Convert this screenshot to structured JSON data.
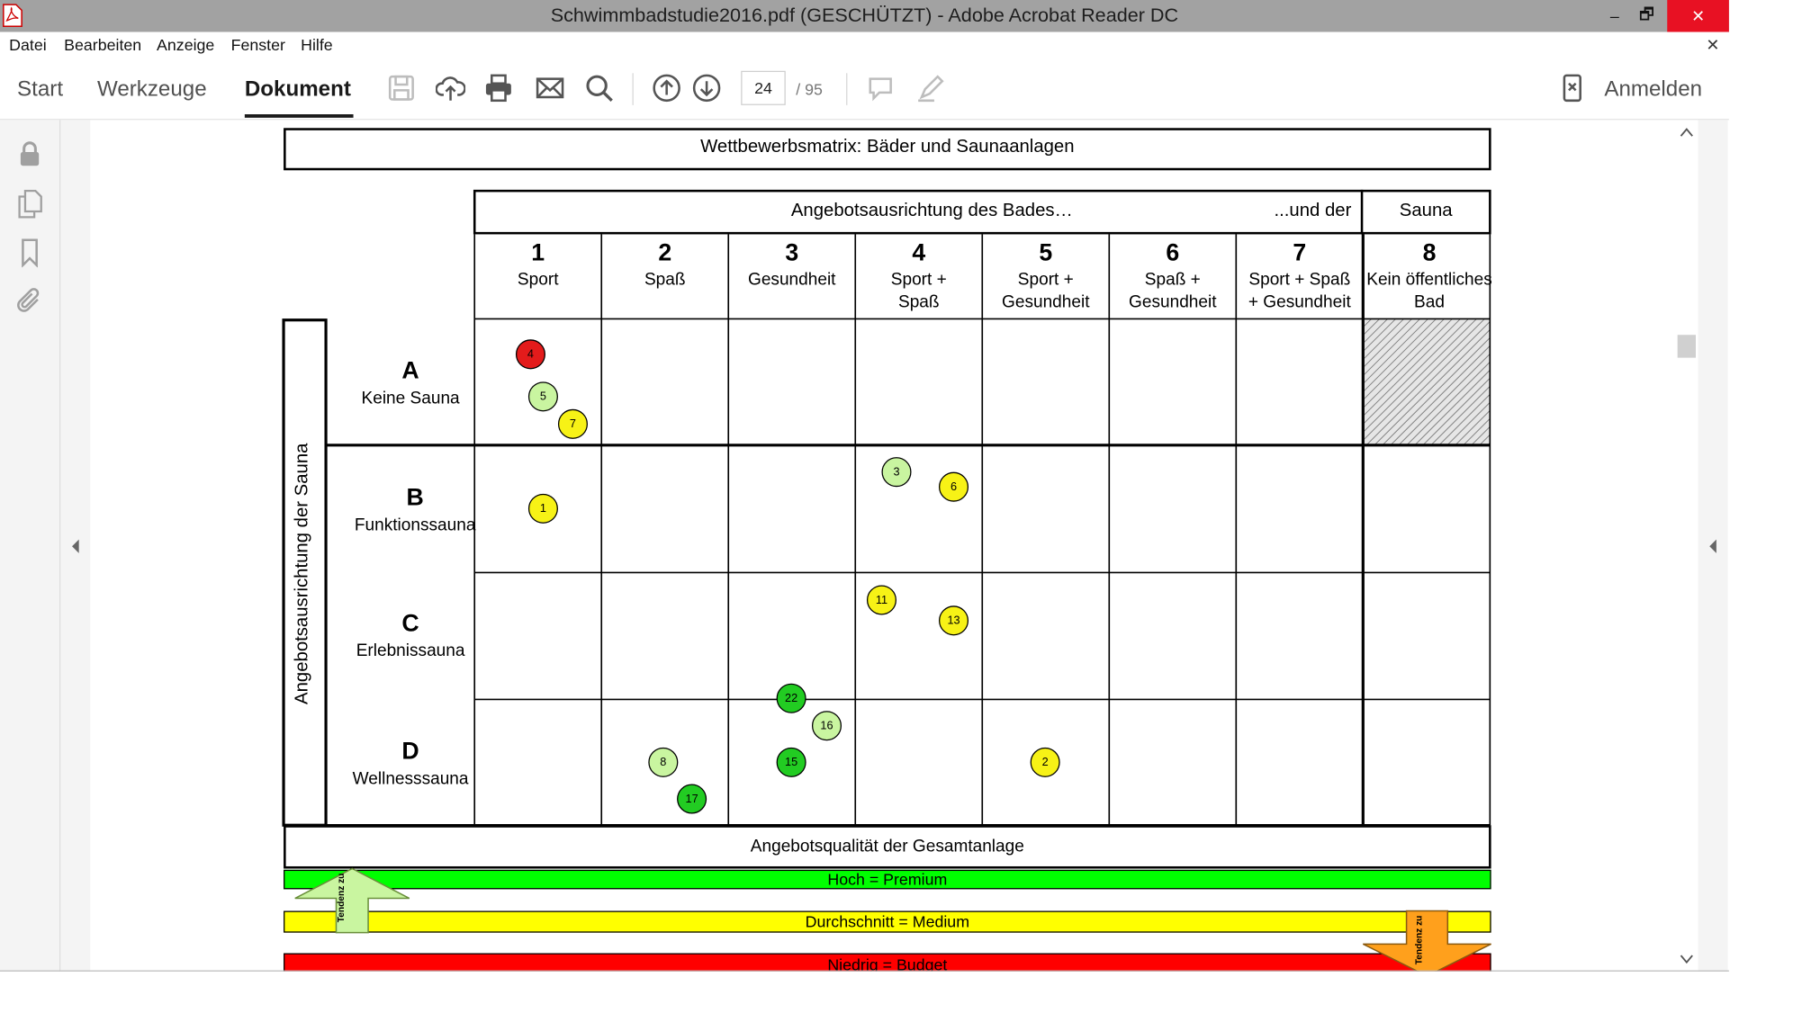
{
  "window": {
    "title": "Schwimmbadstudie2016.pdf (GESCHÜTZT) - Adobe Acrobat Reader DC",
    "minimize": "–",
    "maximize": "🗗",
    "close": "✕"
  },
  "menu": {
    "items": [
      "Datei",
      "Bearbeiten",
      "Anzeige",
      "Fenster",
      "Hilfe"
    ],
    "close_doc": "✕"
  },
  "toolbar": {
    "tabs": [
      "Start",
      "Werkzeuge",
      "Dokument"
    ],
    "active_tab": "Dokument",
    "page_current": "24",
    "page_total": "/ 95",
    "login": "Anmelden",
    "icons": [
      "save-icon",
      "upload-icon",
      "print-icon",
      "mail-icon",
      "search-icon",
      "page-up-icon",
      "page-down-icon",
      "comment-icon",
      "pen-icon",
      "mobile-icon"
    ]
  },
  "sidebar": {
    "icons": [
      "lock-icon",
      "pages-icon",
      "bookmark-icon",
      "attachment-icon"
    ]
  },
  "matrix": {
    "title": "Wettbewerbsmatrix: Bäder und Saunaanlagen",
    "header_main": "Angebotsausrichtung des Bades…",
    "header_und": "...und der",
    "header_sauna": "Sauna",
    "columns": [
      {
        "num": "1",
        "label": "Sport"
      },
      {
        "num": "2",
        "label": "Spaß"
      },
      {
        "num": "3",
        "label": "Gesundheit"
      },
      {
        "num": "4",
        "label": "Sport +\nSpaß"
      },
      {
        "num": "5",
        "label": "Sport +\nGesundheit"
      },
      {
        "num": "6",
        "label": "Spaß +\nGesundheit"
      },
      {
        "num": "7",
        "label": "Sport + Spaß\n+ Gesundheit"
      },
      {
        "num": "8",
        "label": "Kein öffentliches\nBad"
      }
    ],
    "row_axis_label": "Angebotsausrichtung der Sauna",
    "rows": [
      {
        "letter": "A",
        "label": "Keine Sauna"
      },
      {
        "letter": "B",
        "label": "Funktionssauna"
      },
      {
        "letter": "C",
        "label": "Erlebnissauna"
      },
      {
        "letter": "D",
        "label": "Wellnesssauna"
      }
    ],
    "markers": [
      {
        "id": "4",
        "color": "#e31b1b"
      },
      {
        "id": "5",
        "color": "#c9f5a0"
      },
      {
        "id": "7",
        "color": "#f7f216"
      },
      {
        "id": "1",
        "color": "#f7f216"
      },
      {
        "id": "3",
        "color": "#c9f5a0"
      },
      {
        "id": "6",
        "color": "#f7f216"
      },
      {
        "id": "11",
        "color": "#f7f216"
      },
      {
        "id": "13",
        "color": "#f7f216"
      },
      {
        "id": "22",
        "color": "#22cc22"
      },
      {
        "id": "16",
        "color": "#c9f5a0"
      },
      {
        "id": "8",
        "color": "#c9f5a0"
      },
      {
        "id": "17",
        "color": "#22cc22"
      },
      {
        "id": "15",
        "color": "#22cc22"
      },
      {
        "id": "2",
        "color": "#f7f216"
      }
    ],
    "quality_label": "Angebotsqualität der Gesamtanlage",
    "bands": [
      {
        "label": "Hoch = Premium",
        "color": "#00ff00"
      },
      {
        "label": "Durchschnitt = Medium",
        "color": "#ffff00"
      },
      {
        "label": "Niedrig = Budget",
        "color": "#ff0000"
      }
    ],
    "tendency_label": "Tendenz zu"
  }
}
